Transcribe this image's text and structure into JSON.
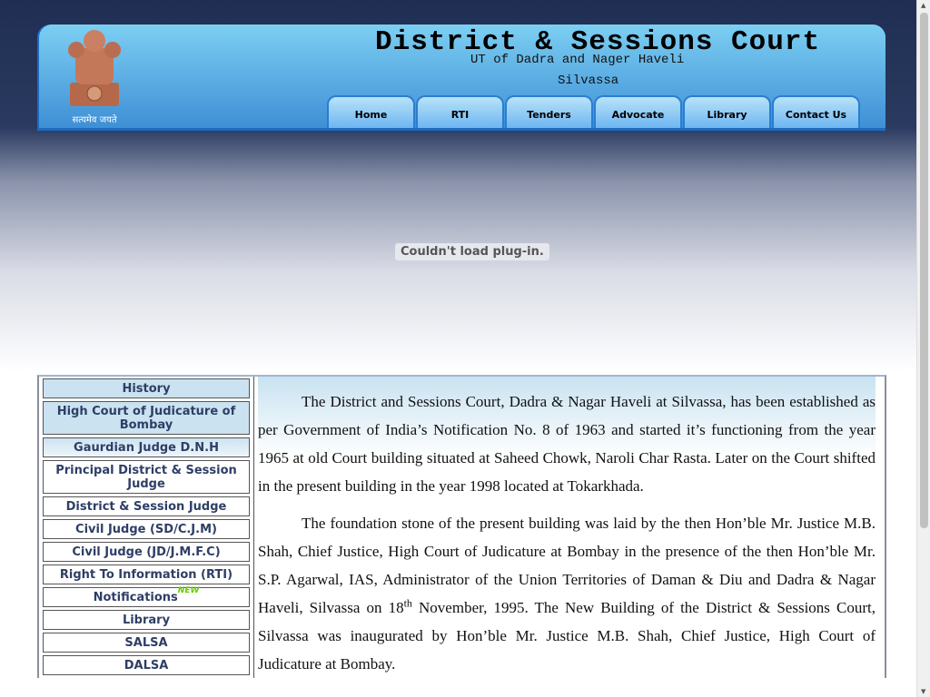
{
  "header": {
    "title": "District & Sessions Court",
    "subtitle": "UT of Dadra and Nager Haveli",
    "city": "Silvassa",
    "emblem_motto": "सत्यमेव जयते"
  },
  "nav": [
    "Home",
    "RTI",
    "Tenders",
    "Advocate",
    "Library",
    "Contact Us"
  ],
  "plugin_message": "Couldn't load plug-in.",
  "sidebar": [
    "History",
    "High Court of Judicature of Bombay",
    "Gaurdian Judge D.N.H",
    "Principal District & Session Judge",
    "District & Session Judge",
    "Civil Judge (SD/C.J.M)",
    "Civil Judge (JD/J.M.F.C)",
    "Right To Information (RTI)",
    "Notifications",
    "Library",
    "SALSA",
    "DALSA"
  ],
  "new_badge": "NEW",
  "content": {
    "p1": "The District and Sessions Court, Dadra & Nagar Haveli at Silvassa, has been established as per Government of India’s Notification No. 8 of 1963 and started it’s functioning from the year 1965 at old Court building situated at Saheed Chowk, Naroli Char Rasta. Later on the Court shifted in the present building in the year 1998 located at Tokarkhada.",
    "p2a": "The foundation stone of the present building was laid by the then Hon’ble Mr. Justice M.B. Shah, Chief Justice, High Court of Judicature at Bombay in the presence of the then Hon’ble Mr. S.P. Agarwal, IAS, Administrator of the Union Territories of Daman & Diu and Dadra & Nagar Haveli, Silvassa on 18",
    "p2sup": "th",
    "p2b": " November, 1995. The New Building of the District & Sessions Court, Silvassa was inaugurated by Hon’ble Mr. Justice M.B. Shah, Chief Justice, High Court of Judicature at Bombay."
  }
}
